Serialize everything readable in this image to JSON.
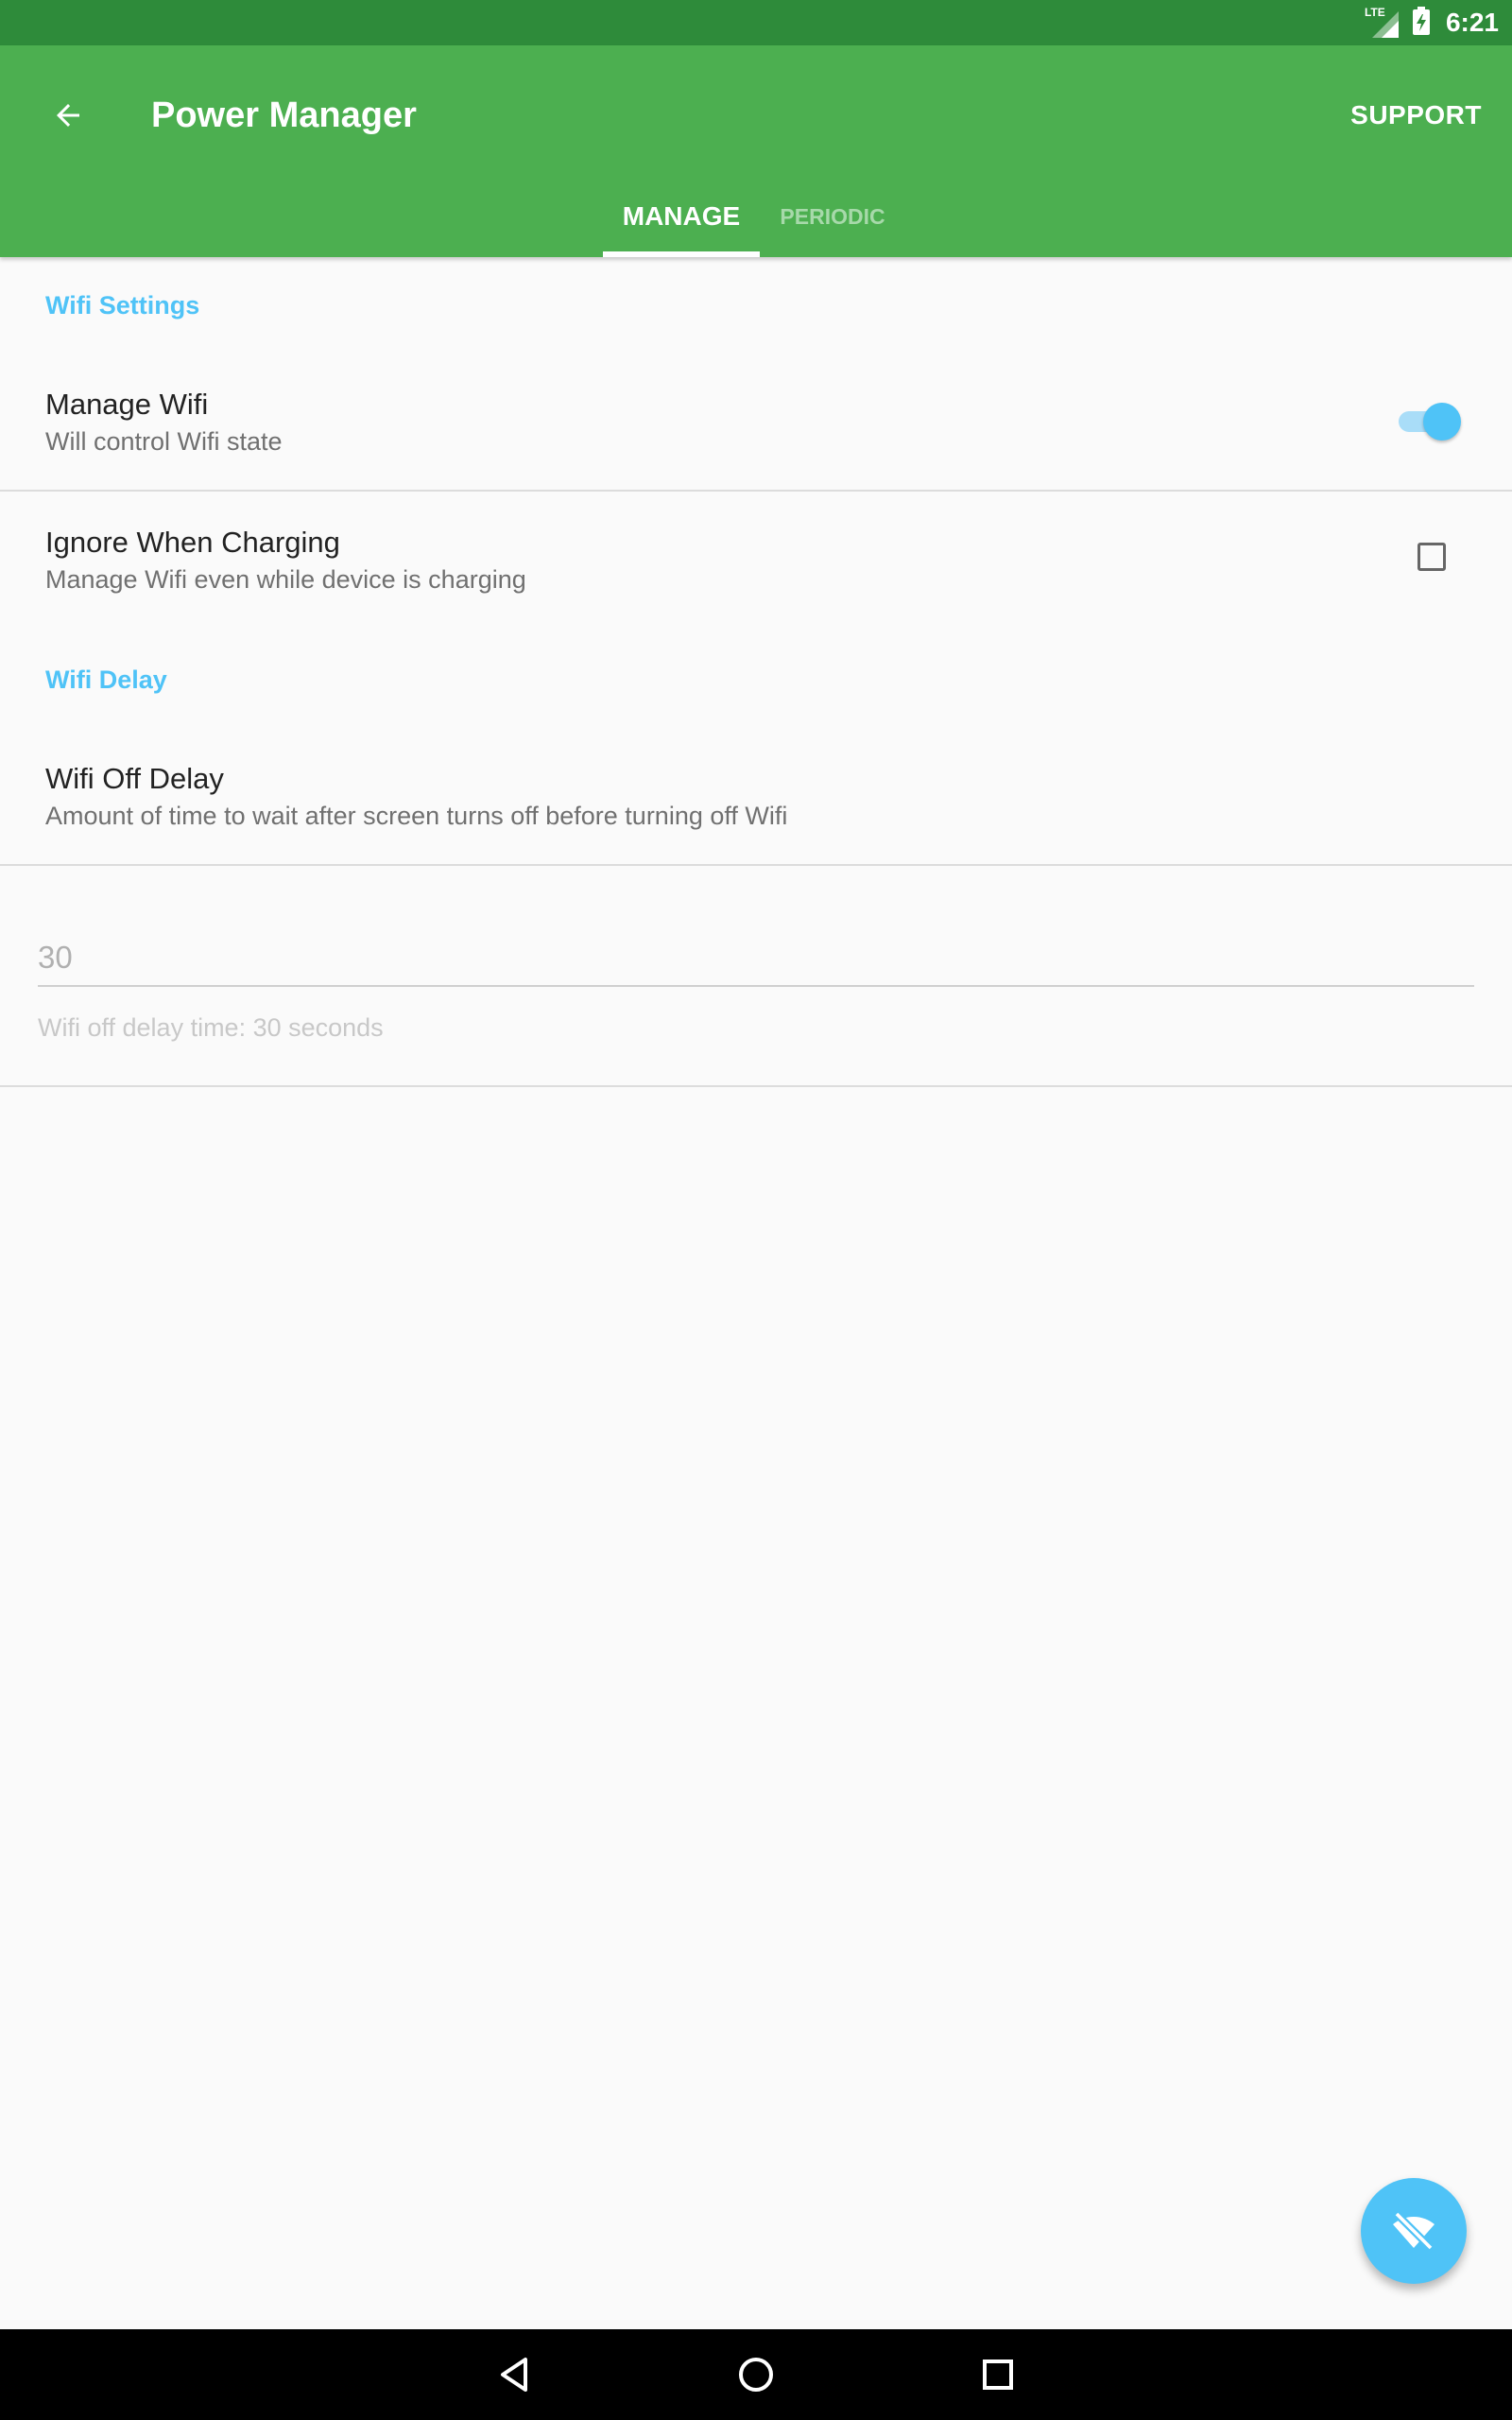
{
  "status_bar": {
    "network_label": "LTE",
    "time": "6:21"
  },
  "app_bar": {
    "title": "Power Manager",
    "action_label": "SUPPORT",
    "background_color": "#4caf50",
    "tabs": [
      {
        "label": "MANAGE",
        "selected": true
      },
      {
        "label": "PERIODIC",
        "selected": false
      }
    ]
  },
  "settings": {
    "wifi_settings_header": "Wifi Settings",
    "manage_wifi": {
      "title": "Manage Wifi",
      "summary": "Will control Wifi state",
      "enabled": true
    },
    "ignore_charging": {
      "title": "Ignore When Charging",
      "summary": "Manage Wifi even while device is charging",
      "checked": false
    },
    "wifi_delay_header": "Wifi Delay",
    "wifi_off_delay": {
      "title": "Wifi Off Delay",
      "summary": "Amount of time to wait after screen turns off before turning off Wifi"
    },
    "delay_input": {
      "value": "30",
      "helper": "Wifi off delay time: 30 seconds"
    }
  },
  "fab": {
    "icon": "wifi-off-icon",
    "color": "#4fc3f7"
  },
  "nav_bar": {
    "back_icon": "back-triangle-icon",
    "home_icon": "home-circle-icon",
    "recents_icon": "recents-square-icon"
  }
}
